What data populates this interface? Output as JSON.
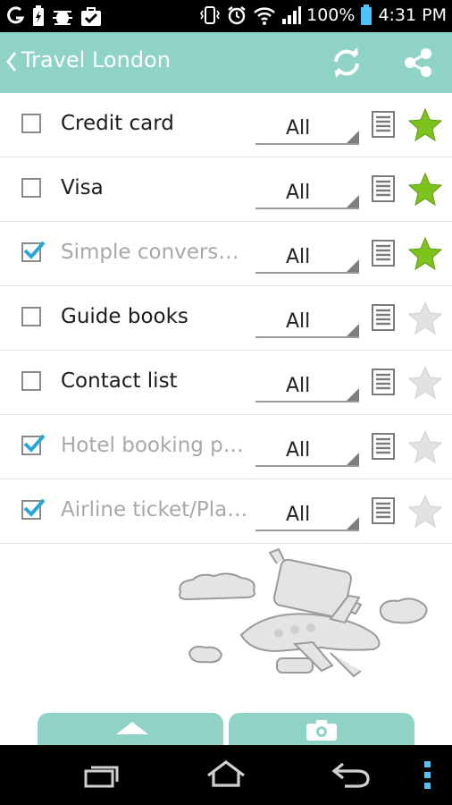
{
  "status_bar": {
    "battery_percent": "100%",
    "time": "4:31 PM"
  },
  "app_bar": {
    "title": "Travel London",
    "back_icon": "chevron-left-icon",
    "actions": [
      "refresh-icon",
      "share-icon"
    ]
  },
  "items": [
    {
      "label": "Credit card",
      "checked": false,
      "filter": "All",
      "starred": true
    },
    {
      "label": "Visa",
      "checked": false,
      "filter": "All",
      "starred": true
    },
    {
      "label": "Simple conversa…",
      "checked": true,
      "filter": "All",
      "starred": true
    },
    {
      "label": "Guide books",
      "checked": false,
      "filter": "All",
      "starred": false
    },
    {
      "label": "Contact list",
      "checked": false,
      "filter": "All",
      "starred": false
    },
    {
      "label": "Hotel booking pri…",
      "checked": true,
      "filter": "All",
      "starred": false
    },
    {
      "label": "Airline ticket/Pla…",
      "checked": true,
      "filter": "All",
      "starred": false
    }
  ],
  "bottom_tabs": [
    "up-arrow-icon",
    "camera-icon"
  ],
  "colors": {
    "accent": "#8fd3c7",
    "star_on": "#7cc41d",
    "star_off": "#d9d9d9",
    "check": "#2aa7d8"
  }
}
